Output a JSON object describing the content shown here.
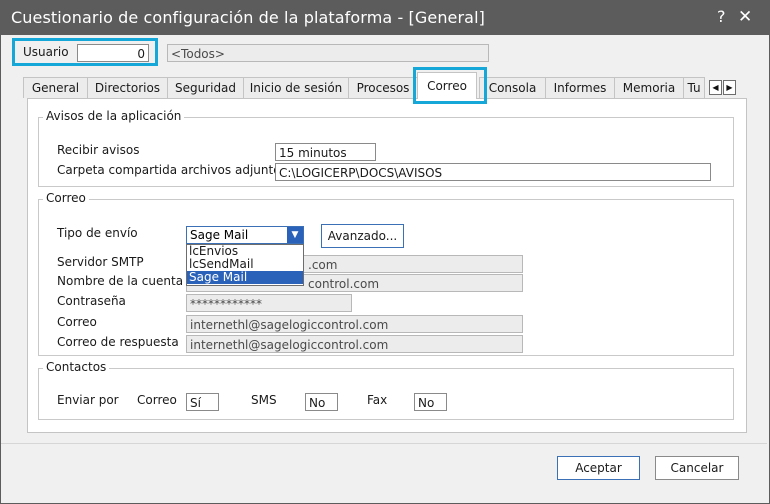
{
  "window": {
    "title": "Cuestionario de configuración de la plataforma - [General]",
    "help_label": "?",
    "close_label": "✕"
  },
  "user": {
    "label": "Usuario",
    "value": "0",
    "name": "<Todos>"
  },
  "tabs": [
    {
      "label": "General",
      "active": false
    },
    {
      "label": "Directorios",
      "active": false
    },
    {
      "label": "Seguridad",
      "active": false
    },
    {
      "label": "Inicio de sesión",
      "active": false
    },
    {
      "label": "Procesos",
      "active": false
    },
    {
      "label": "Correo",
      "active": true
    },
    {
      "label": "Consola",
      "active": false
    },
    {
      "label": "Informes",
      "active": false
    },
    {
      "label": "Memoria",
      "active": false
    },
    {
      "label": "Tu",
      "active": false
    }
  ],
  "tab_scroll": {
    "left": "◀",
    "right": "▶"
  },
  "avisos": {
    "title": "Avisos de la aplicación",
    "recibir_label": "Recibir avisos",
    "recibir_value": "15 minutos",
    "carpeta_label": "Carpeta compartida archivos adjuntos",
    "carpeta_value": "C:\\LOGICERP\\DOCS\\AVISOS"
  },
  "correo": {
    "title": "Correo",
    "tipo_label": "Tipo de envío",
    "tipo_value": "Sage Mail",
    "options": [
      "lcEnvios",
      "lcSendMail",
      "Sage Mail"
    ],
    "selected_option": "Sage Mail",
    "avanzado_label": "Avanzado...",
    "smtp_label": "Servidor SMTP",
    "smtp_value": ".com",
    "cuenta_label": "Nombre de la cuenta",
    "cuenta_value": "control.com",
    "password_label": "Contraseña",
    "password_value": "************",
    "correo_label": "Correo",
    "correo_value": "internethl@sagelogiccontrol.com",
    "respuesta_label": "Correo de respuesta",
    "respuesta_value": "internethl@sagelogiccontrol.com"
  },
  "contactos": {
    "title": "Contactos",
    "enviar_label": "Enviar por",
    "correo_label": "Correo",
    "correo_value": "Sí",
    "sms_label": "SMS",
    "sms_value": "No",
    "fax_label": "Fax",
    "fax_value": "No"
  },
  "buttons": {
    "accept": "Aceptar",
    "cancel": "Cancelar"
  },
  "colors": {
    "titlebar": "#5c5c5c",
    "highlight": "#14a7d8",
    "selection": "#2a62b9"
  }
}
